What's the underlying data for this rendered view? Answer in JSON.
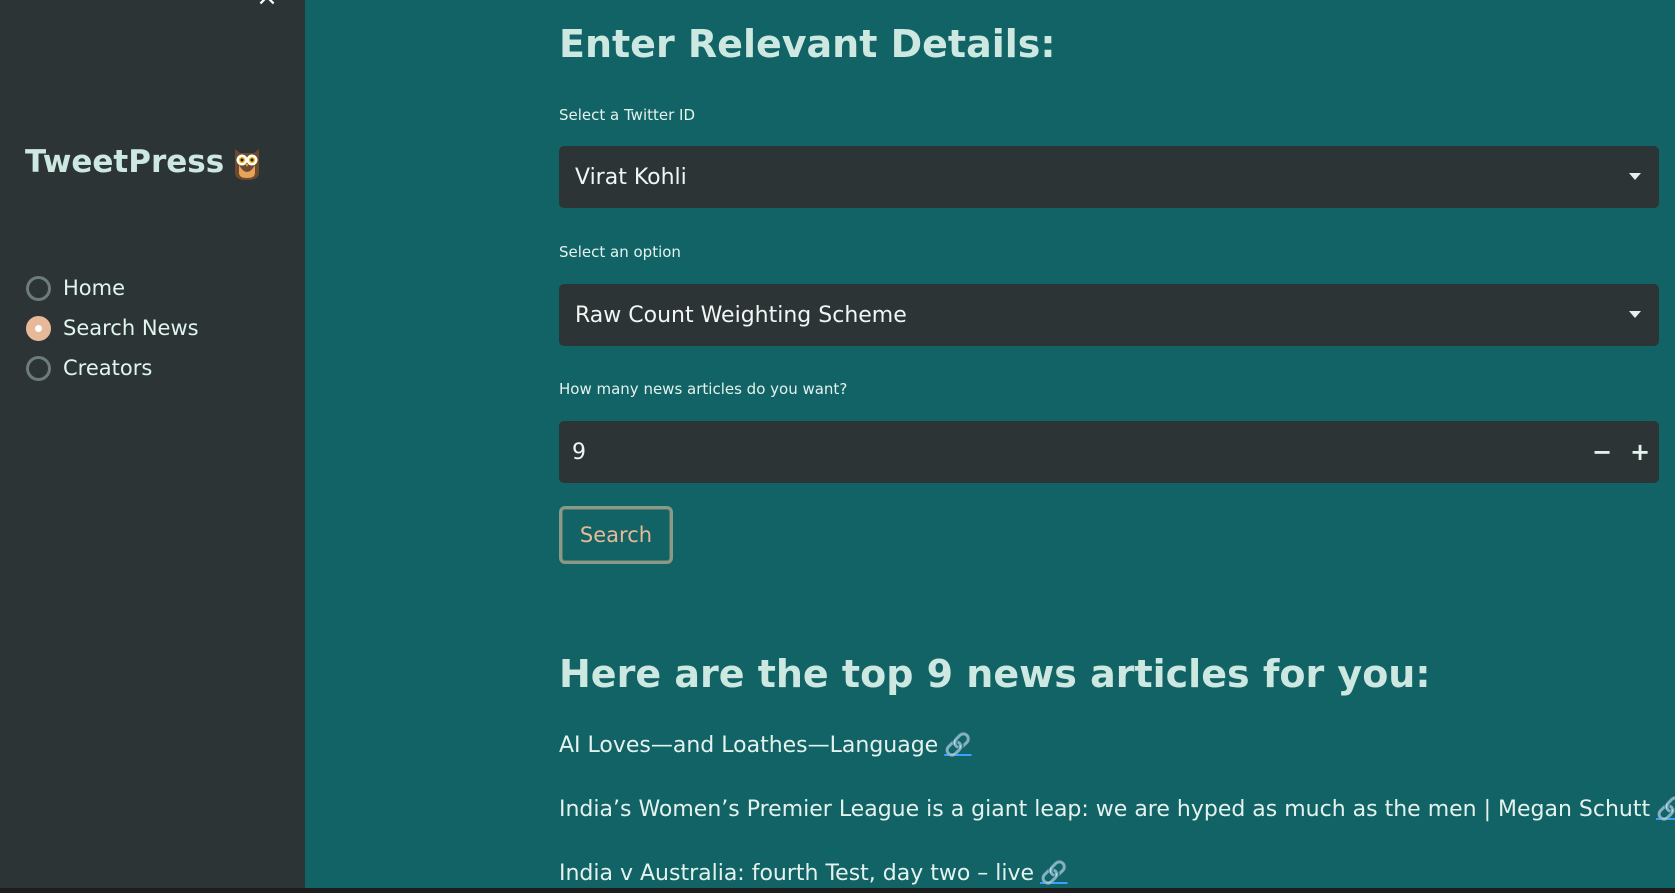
{
  "sidebar": {
    "close_label": "×",
    "brand": "TweetPress",
    "brand_icon": "owl-icon",
    "nav": [
      {
        "label": "Home",
        "selected": false
      },
      {
        "label": "Search News",
        "selected": true
      },
      {
        "label": "Creators",
        "selected": false
      }
    ]
  },
  "main": {
    "title": "Enter Relevant Details:",
    "twitter_label": "Select a Twitter ID",
    "twitter_value": "Virat Kohli",
    "option_label": "Select an option",
    "option_value": "Raw Count Weighting Scheme",
    "count_label": "How many news articles do you want?",
    "count_value": "9",
    "minus_label": "−",
    "plus_label": "+",
    "search_label": "Search",
    "results_title": "Here are the top 9 news articles for you:",
    "articles": [
      {
        "title": "AI Loves—and Loathes—Language",
        "link_icon": "🔗"
      },
      {
        "title": "India’s Women’s Premier League is a giant leap: we are hyped as much as the men | Megan Schutt",
        "link_icon": "🔗"
      },
      {
        "title": "India v Australia: fourth Test, day two – live",
        "link_icon": "🔗"
      }
    ]
  },
  "colors": {
    "sidebar_bg": "#2d3436",
    "main_bg": "#126366",
    "input_bg": "#2d3436",
    "accent": "#e8b998",
    "heading": "#cde8e1"
  }
}
